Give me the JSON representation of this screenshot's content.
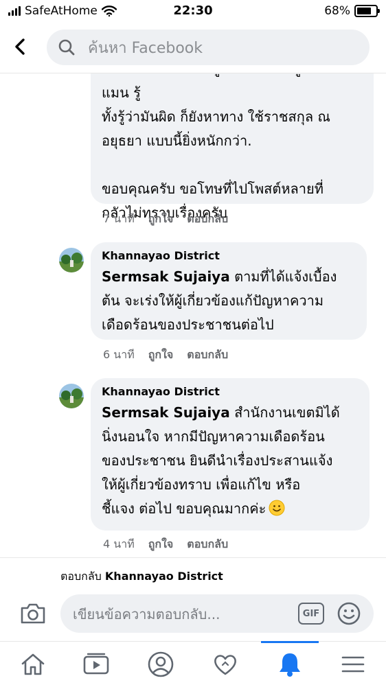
{
  "status": {
    "carrier": "SafeAtHome",
    "time": "22:30",
    "battery": "68%",
    "battery_level": 0.68
  },
  "search": {
    "placeholder": "ค้นหา Facebook"
  },
  "comments": [
    {
      "lines": [
        "แต่ถ้าเขาทำเป็นไม่รู้และทางฝ่ายดูแลเขาไม่แมน รู้",
        "ทั้งรู้ว่ามันผิด ก็ยังหาทาง ใช้ราชสกุล ณ",
        "อยุธยา แบบนี้ยิ่งหนักกว่า.",
        "",
        "ขอบคุณครับ ขอโทษที่ไปโพสต์หลายที่",
        "กลัวไม่ทราบเรื่องครับ"
      ],
      "time": "7 นาที",
      "like": "ถูกใจ",
      "reply": "ตอบกลับ"
    },
    {
      "author": "Khannayao District",
      "mention": "Sermsak Sujaiya",
      "line1": "ตามที่ได้แจ้งเบื้อง",
      "lines": [
        "ต้น จะเร่งให้ผู้เกี่ยวข้องแก้ปัญหาความ",
        "เดือดร้อนของประชาชนต่อไป"
      ],
      "time": "6 นาที",
      "like": "ถูกใจ",
      "reply": "ตอบกลับ"
    },
    {
      "author": "Khannayao District",
      "mention": "Sermsak Sujaiya",
      "line1": "สำนักงานเขตมิได้",
      "lines": [
        "นิ่งนอนใจ หากมีปัญหาความเดือดร้อน",
        "ของประชาชน ยินดีนำเรื่องประสานแจ้ง",
        "ให้ผู้เกี่ยวข้องทราบ เพื่อแก้ไข หรือ"
      ],
      "last_line": "ชี้แจง ต่อไป ขอบคุณมากค่ะ",
      "time": "4 นาที",
      "like": "ถูกใจ",
      "reply": "ตอบกลับ"
    }
  ],
  "reply_bar": {
    "label": "ตอบกลับ",
    "target": "Khannayao District",
    "placeholder": "เขียนข้อความตอบกลับ...",
    "gif": "GIF"
  },
  "icons": {
    "back": "chevron-left-icon",
    "search": "search-icon",
    "camera": "camera-icon",
    "emoji": "smiley-icon",
    "home": "home-icon",
    "watch": "video-play-icon",
    "profile": "profile-icon",
    "dating": "heart-icon",
    "notifications": "bell-icon",
    "menu": "hamburger-icon"
  },
  "colors": {
    "accent": "#1877f2",
    "bubble": "#f0f2f5",
    "meta": "#65676b"
  }
}
